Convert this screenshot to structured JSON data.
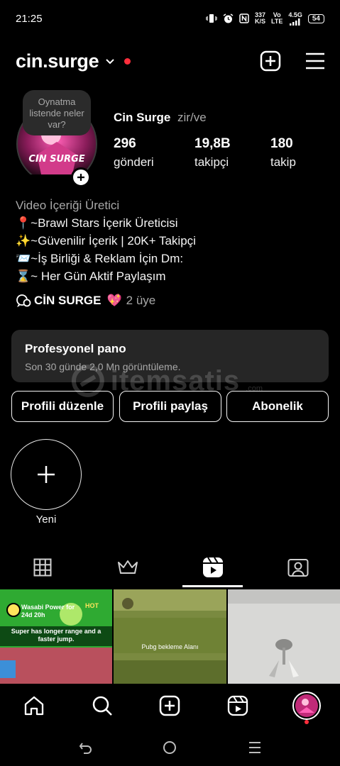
{
  "status_bar": {
    "time": "21:25",
    "net_speed_value": "337",
    "net_speed_unit": "K/S",
    "volte_top": "Vo",
    "volte_bottom": "LTE",
    "network": "4.5G",
    "battery": "54",
    "icons": [
      "vibrate-icon",
      "alarm-icon",
      "nfc-icon",
      "signal-icon"
    ]
  },
  "header": {
    "username": "cin.surge",
    "icons": [
      "chevron-down-icon",
      "new-post-icon",
      "menu-icon"
    ],
    "notification_dot_color": "#ff2e3c"
  },
  "profile": {
    "note": "Oynatma listende neler var?",
    "display_name": "Cin Surge",
    "pronouns": "zir/ve",
    "avatar_text": "CIN SURGE",
    "stats": [
      {
        "value": "296",
        "label": "gönderi"
      },
      {
        "value": "19,8B",
        "label": "takipçi"
      },
      {
        "value": "180",
        "label": "takip"
      }
    ],
    "category": "Video İçeriği Üretici",
    "bio_lines": [
      "📍~Brawl Stars İçerik Üreticisi",
      "✨~Güvenilir İçerik | 20K+ Takipçi",
      "📨~İş Birliği & Reklam İçin Dm:",
      "⌛~ Her Gün Aktif Paylaşım"
    ],
    "channel": {
      "name": "CİN SURGE",
      "heart": "💖",
      "members": "2 üye"
    }
  },
  "dashboard": {
    "title": "Profesyonel pano",
    "subtitle": "Son 30 günde 2,0 Mn görüntüleme."
  },
  "watermark": {
    "text": "itemsatis",
    "suffix": ".com"
  },
  "buttons": {
    "edit": "Profili düzenle",
    "share": "Profili paylaş",
    "subscription": "Abonelik"
  },
  "highlights": {
    "new_label": "Yeni"
  },
  "tabs": [
    {
      "name": "grid-icon",
      "active": false
    },
    {
      "name": "crown-icon",
      "active": false
    },
    {
      "name": "reels-icon",
      "active": true
    },
    {
      "name": "tagged-icon",
      "active": false
    }
  ],
  "posts": [
    {
      "title": "Wasabi Power for 24d 20h",
      "caption": "Super has longer range and a faster jump.",
      "badge": "HOT"
    },
    {
      "caption": "Pubg bekleme Alanı"
    },
    {
      "caption": ""
    }
  ],
  "bottom_nav": [
    "home-icon",
    "search-icon",
    "create-icon",
    "reels-icon",
    "profile-avatar"
  ],
  "colors": {
    "background": "#000000",
    "card": "#262626",
    "secondary_text": "#a8a8a8",
    "accent_red": "#ff2e3c"
  }
}
